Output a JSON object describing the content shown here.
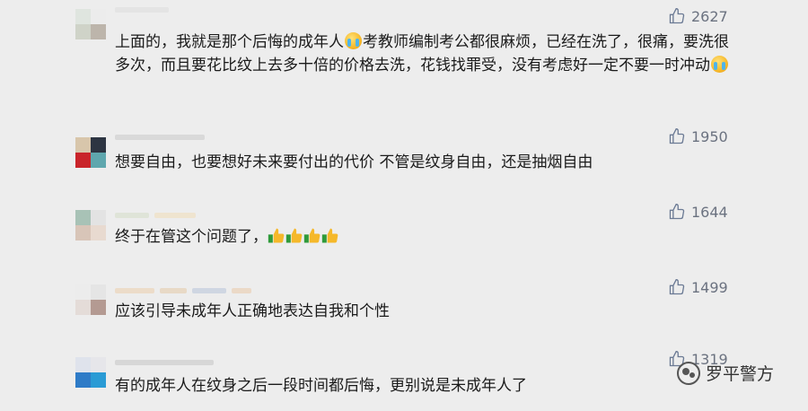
{
  "comments": [
    {
      "text_parts": [
        "上面的，我就是那个后悔的成年人",
        "考教师编制考公都很麻烦，已经在洗了，很痛，要洗很多次，而且要花比纹上去多十倍的价格去洗，花钱找罪受，没有考虑好一定不要一时冲动"
      ],
      "likes": "2627",
      "emoji": "crying-face-icon"
    },
    {
      "text": "想要自由，也要想好未来要付出的代价 不管是纹身自由，还是抽烟自由",
      "likes": "1950"
    },
    {
      "text": "终于在管这个问题了，",
      "likes": "1644",
      "emoji": "thumbs-up-icon"
    },
    {
      "text": "应该引导未成年人正确地表达自我和个性",
      "likes": "1499"
    },
    {
      "text": "有的成年人在纹身之后一段时间都后悔，更别说是未成年人了",
      "likes": "1319"
    }
  ],
  "watermark": {
    "text": "罗平警方",
    "icon": "wechat-icon"
  },
  "colors": {
    "background": "#ededed",
    "like_gray": "#6b7280",
    "emoji_yellow": "#f6b92b"
  }
}
